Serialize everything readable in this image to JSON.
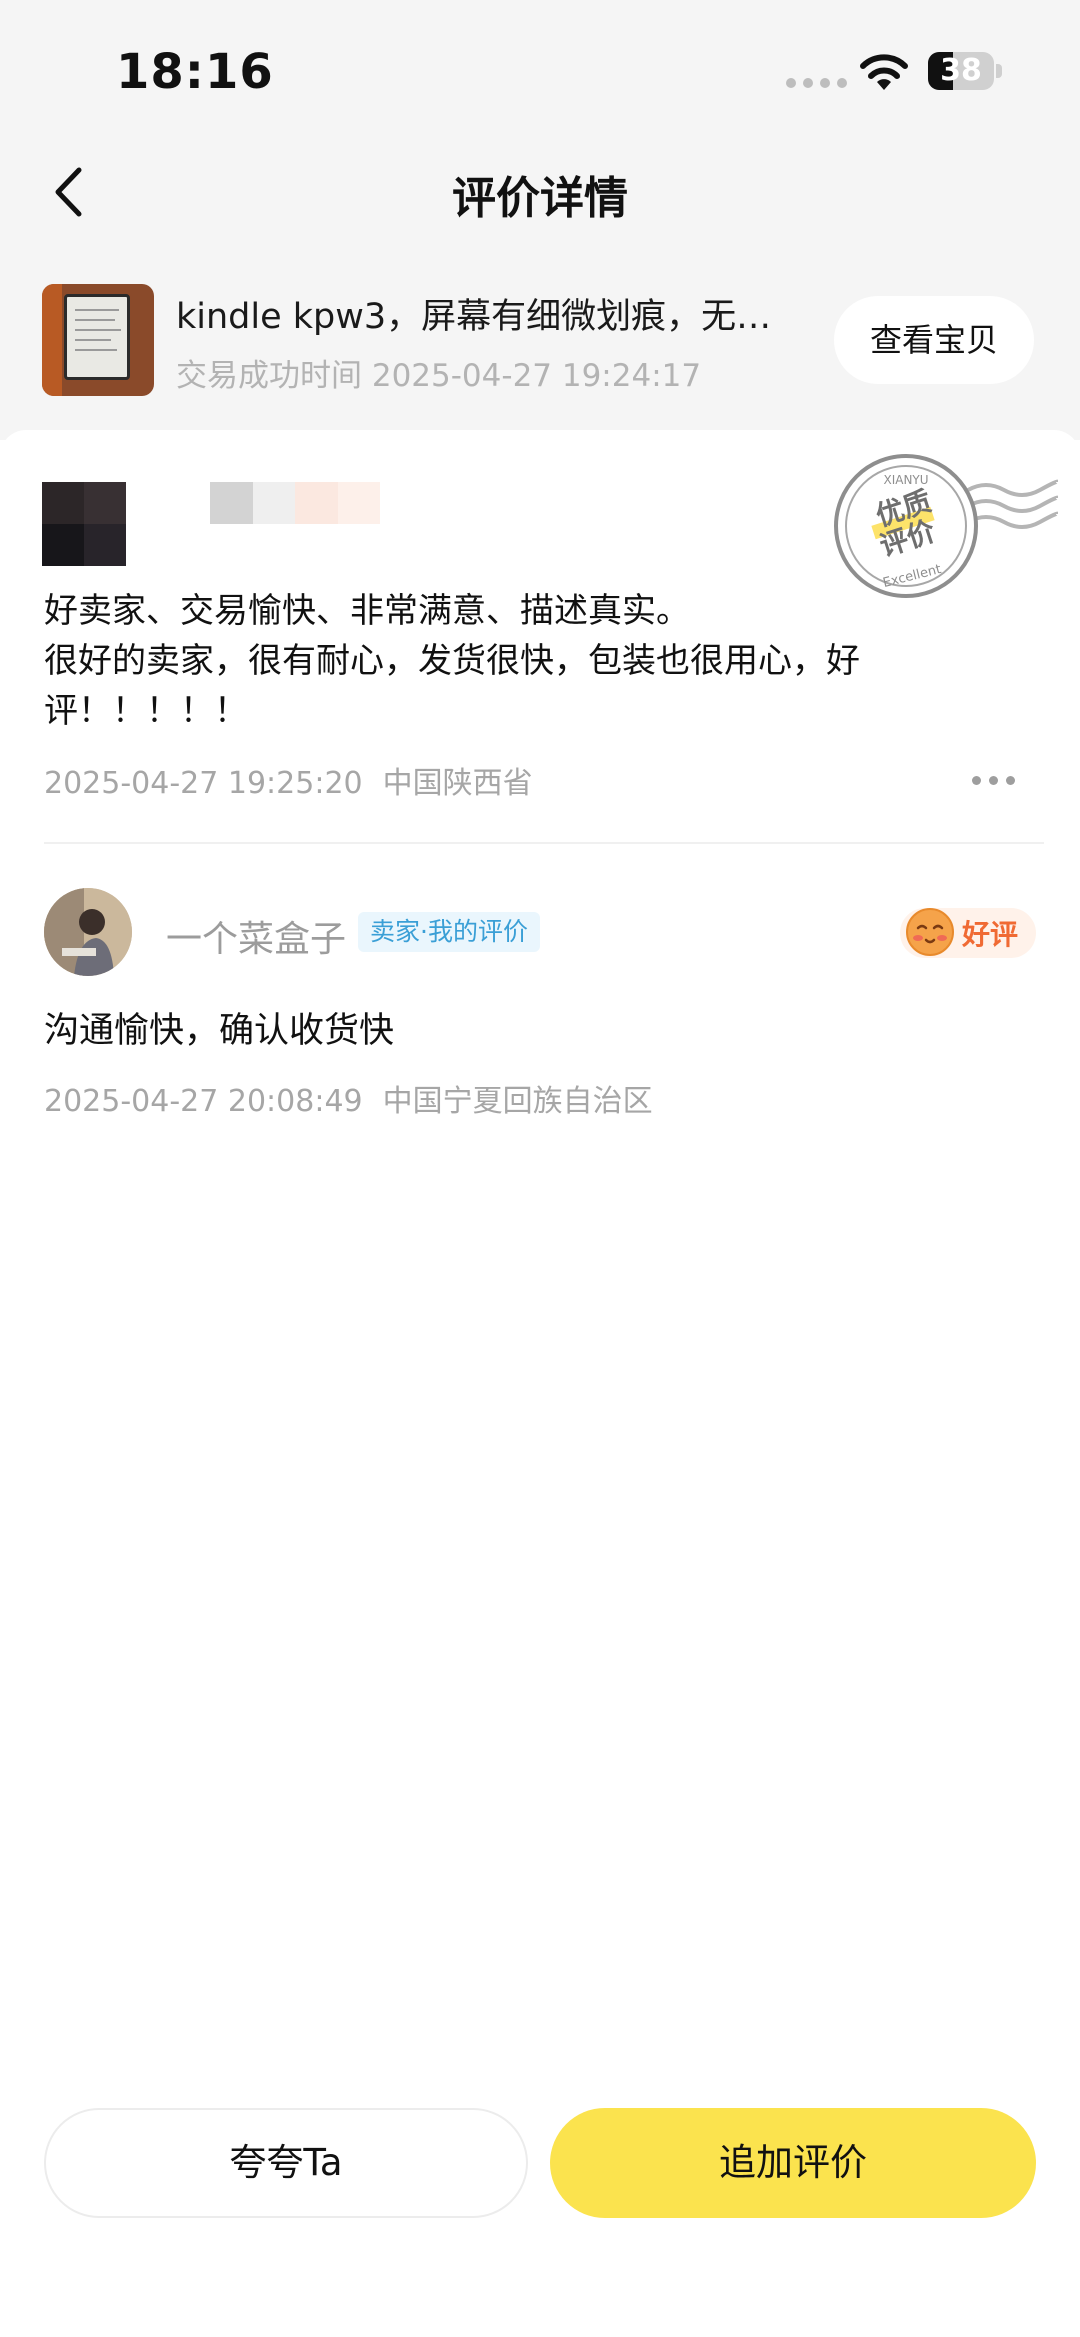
{
  "status_bar": {
    "time": "18:16",
    "battery": "38",
    "battery_level": 0.38
  },
  "nav": {
    "title": "评价详情"
  },
  "product": {
    "title": "kindle kpw3，屏幕有细微划痕，无…",
    "time": "交易成功时间 2025-04-27 19:24:17",
    "view_button": "查看宝贝"
  },
  "stamp": {
    "top_text": "XIANYU",
    "main_line1": "优质",
    "main_line2": "评价",
    "bottom_text": "Excellent"
  },
  "buyer_review": {
    "lines": [
      "好卖家、交易愉快、非常满意、描述真实。",
      "很好的卖家，很有耐心，发货很快，包装也很用心，好",
      "评！！！！！"
    ],
    "date": "2025-04-27 19:25:20",
    "location": "中国陕西省"
  },
  "seller_review": {
    "name": "一个菜盒子",
    "tag": "卖家·我的评价",
    "rating": "好评",
    "comment": "沟通愉快，确认收货快",
    "date": "2025-04-27 20:08:49",
    "location": "中国宁夏回族自治区"
  },
  "actions": {
    "praise": "夸夸Ta",
    "add_review": "追加评价"
  },
  "colors": {
    "accent_yellow": "#fbe34e",
    "seller_tag_blue": "#3a9fd6",
    "good_orange": "#f06a33"
  }
}
